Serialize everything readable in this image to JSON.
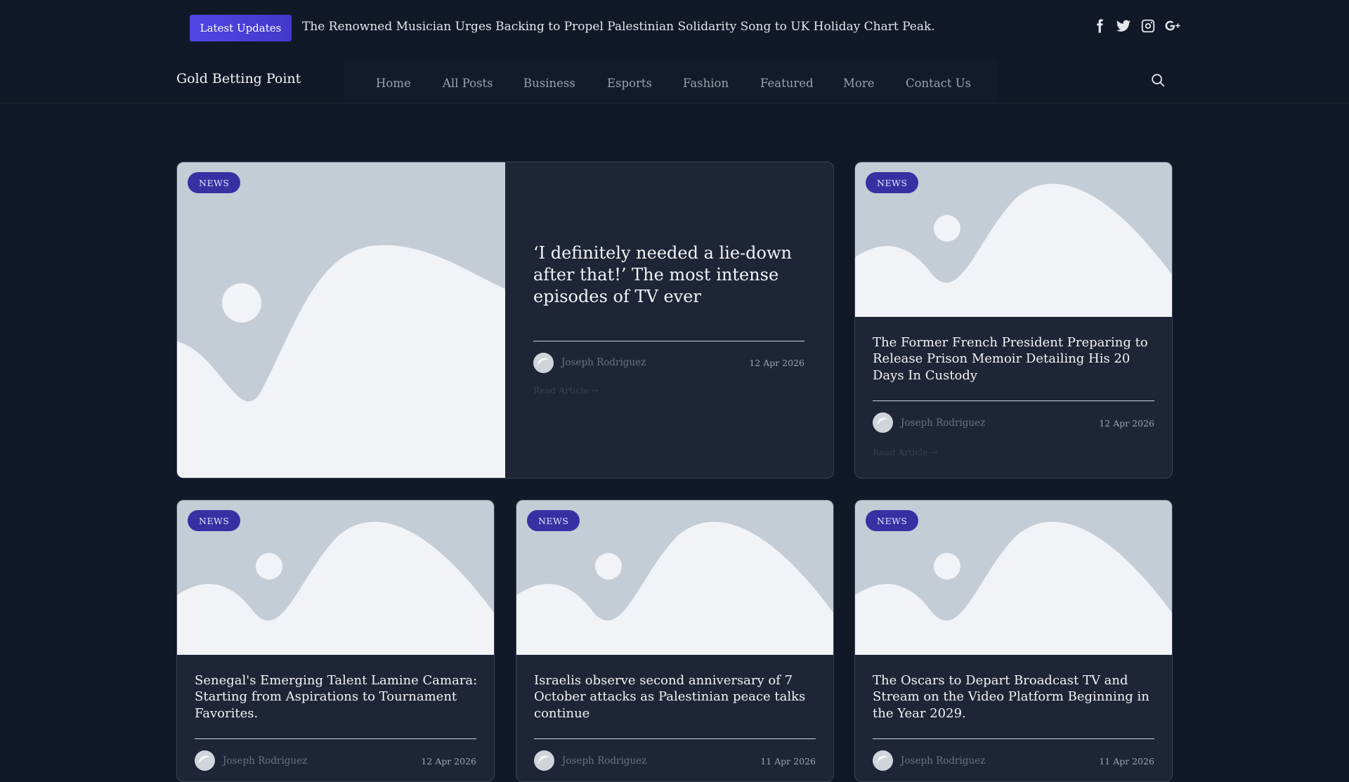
{
  "topbar": {
    "badge": "Latest Updates",
    "ticker": "The Renowned Musician Urges Backing to Propel Palestinian Solidarity Song to UK Holiday Chart Peak.",
    "social": [
      "facebook-icon",
      "twitter-icon",
      "instagram-icon",
      "google-plus-icon"
    ]
  },
  "nav": {
    "brand": "Gold Betting Point",
    "items": [
      "Home",
      "All Posts",
      "Business",
      "Esports",
      "Fashion",
      "Featured",
      "More",
      "Contact Us"
    ]
  },
  "cards": [
    {
      "tag": "NEWS",
      "title": "‘I definitely needed a lie-down after that!’ The most intense episodes of TV ever",
      "author": "Joseph Rodriguez",
      "date": "12 Apr 2026",
      "read": "Read Article →"
    },
    {
      "tag": "NEWS",
      "title": "The Former French President Preparing to Release Prison Memoir Detailing His 20 Days In Custody",
      "author": "Joseph Rodriguez",
      "date": "12 Apr 2026",
      "read": "Read Article →"
    },
    {
      "tag": "NEWS",
      "title": "Senegal's Emerging Talent Lamine Camara: Starting from Aspirations to Tournament Favorites.",
      "author": "Joseph Rodriguez",
      "date": "12 Apr 2026"
    },
    {
      "tag": "NEWS",
      "title": "Israelis observe second anniversary of 7 October attacks as Palestinian peace talks continue",
      "author": "Joseph Rodriguez",
      "date": "11 Apr 2026"
    },
    {
      "tag": "NEWS",
      "title": "The Oscars to Depart Broadcast TV and Stream on the Video Platform Beginning in the Year 2029.",
      "author": "Joseph Rodriguez",
      "date": "11 Apr 2026"
    }
  ],
  "colors": {
    "background": "#111827",
    "card": "#1e2537",
    "accent": "#4f46e5",
    "placeholder": "#c4ccd6"
  }
}
